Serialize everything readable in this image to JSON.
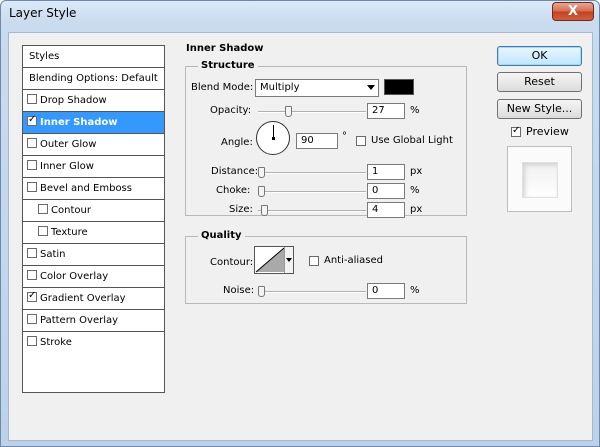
{
  "window": {
    "title": "Layer Style",
    "close_glyph": "X"
  },
  "styles_panel": {
    "header": "Styles",
    "blending": "Blending Options: Default",
    "items": [
      {
        "label": "Drop Shadow",
        "checked": false,
        "selected": false,
        "indent": false
      },
      {
        "label": "Inner Shadow",
        "checked": true,
        "selected": true,
        "indent": false
      },
      {
        "label": "Outer Glow",
        "checked": false,
        "selected": false,
        "indent": false
      },
      {
        "label": "Inner Glow",
        "checked": false,
        "selected": false,
        "indent": false
      },
      {
        "label": "Bevel and Emboss",
        "checked": false,
        "selected": false,
        "indent": false
      },
      {
        "label": "Contour",
        "checked": false,
        "selected": false,
        "indent": true
      },
      {
        "label": "Texture",
        "checked": false,
        "selected": false,
        "indent": true
      },
      {
        "label": "Satin",
        "checked": false,
        "selected": false,
        "indent": false
      },
      {
        "label": "Color Overlay",
        "checked": false,
        "selected": false,
        "indent": false
      },
      {
        "label": "Gradient Overlay",
        "checked": true,
        "selected": false,
        "indent": false
      },
      {
        "label": "Pattern Overlay",
        "checked": false,
        "selected": false,
        "indent": false
      },
      {
        "label": "Stroke",
        "checked": false,
        "selected": false,
        "indent": false
      }
    ]
  },
  "inner_shadow": {
    "title": "Inner Shadow",
    "structure": {
      "title": "Structure",
      "blend_mode_label": "Blend Mode:",
      "blend_mode_value": "Multiply",
      "shadow_color": "#000000",
      "opacity_label": "Opacity:",
      "opacity_value": "27",
      "opacity_unit": "%",
      "opacity_level": 0.27,
      "angle_label": "Angle:",
      "angle_value": "90",
      "angle_unit": "°",
      "use_global_light_label": "Use Global Light",
      "use_global_light": false,
      "distance_label": "Distance:",
      "distance_value": "1",
      "distance_unit": "px",
      "choke_label": "Choke:",
      "choke_value": "0",
      "choke_unit": "%",
      "size_label": "Size:",
      "size_value": "4",
      "size_unit": "px"
    },
    "quality": {
      "title": "Quality",
      "contour_label": "Contour:",
      "anti_aliased_label": "Anti-aliased",
      "anti_aliased": false,
      "noise_label": "Noise:",
      "noise_value": "0",
      "noise_unit": "%"
    }
  },
  "buttons": {
    "ok": "OK",
    "reset": "Reset",
    "new_style": "New Style...",
    "preview_label": "Preview",
    "preview_checked": true
  },
  "colors": {
    "selection": "#3399ff",
    "dialog_bg": "#f0f0f0"
  }
}
